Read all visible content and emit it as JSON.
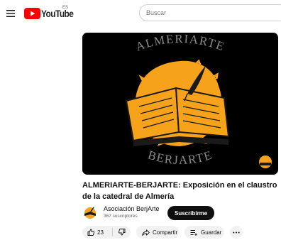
{
  "header": {
    "logo_text": "YouTube",
    "region_code": "ES",
    "search_placeholder": "Buscar"
  },
  "thumbnail": {
    "top_text": "ALMERIARTE",
    "bottom_text": "BERJARTE",
    "colors": {
      "background": "#000000",
      "sun": "#F7A21B"
    }
  },
  "video": {
    "title": "ALMERIARTE-BERJARTE: Exposición en el claustro de la catedral de Almería"
  },
  "channel": {
    "name": "Asociación BerjArte",
    "subscribers": "367 suscriptores",
    "subscribe_label": "Suscribirme"
  },
  "actions": {
    "like_count": "23",
    "share_label": "Compartir",
    "save_label": "Guardar"
  },
  "colors": {
    "brand_red": "#FF0000",
    "text": "#0f0f0f",
    "secondary": "#606060",
    "pill": "#f2f2f2"
  }
}
